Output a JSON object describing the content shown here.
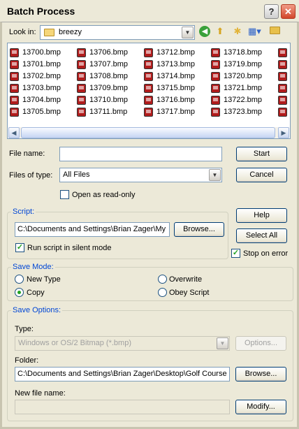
{
  "window": {
    "title": "Batch Process"
  },
  "look_in": {
    "label": "Look in:",
    "folder": "breezy"
  },
  "files": {
    "columns": [
      [
        "13700.bmp",
        "13701.bmp",
        "13702.bmp",
        "13703.bmp",
        "13704.bmp",
        "13705.bmp"
      ],
      [
        "13706.bmp",
        "13707.bmp",
        "13708.bmp",
        "13709.bmp",
        "13710.bmp",
        "13711.bmp"
      ],
      [
        "13712.bmp",
        "13713.bmp",
        "13714.bmp",
        "13715.bmp",
        "13716.bmp",
        "13717.bmp"
      ],
      [
        "13718.bmp",
        "13719.bmp",
        "13720.bmp",
        "13721.bmp",
        "13722.bmp",
        "13723.bmp"
      ]
    ]
  },
  "file_name": {
    "label": "File name:",
    "value": ""
  },
  "file_type": {
    "label": "Files of type:",
    "value": "All Files"
  },
  "read_only": {
    "label": "Open as read-only",
    "checked": false
  },
  "buttons": {
    "start": "Start",
    "cancel": "Cancel",
    "help": "Help",
    "select_all": "Select All",
    "browse_script": "Browse...",
    "options": "Options...",
    "browse_folder": "Browse...",
    "modify": "Modify..."
  },
  "script": {
    "title": "Script:",
    "path": "C:\\Documents and Settings\\Brian Zager\\My",
    "silent_label": "Run script in silent mode",
    "silent_checked": true
  },
  "stop_on_error": {
    "label": "Stop on error",
    "checked": true
  },
  "save_mode": {
    "title": "Save Mode:",
    "new_type": "New Type",
    "overwrite": "Overwrite",
    "copy": "Copy",
    "obey_script": "Obey Script",
    "selected": "copy"
  },
  "save_options": {
    "title": "Save Options:",
    "type_label": "Type:",
    "type_value": "Windows or OS/2 Bitmap (*.bmp)",
    "folder_label": "Folder:",
    "folder_value": "C:\\Documents and Settings\\Brian Zager\\Desktop\\Golf Course",
    "new_file_label": "New file name:",
    "new_file_value": ""
  },
  "colors": {
    "accent": "#0046d5",
    "check": "#21a121"
  }
}
